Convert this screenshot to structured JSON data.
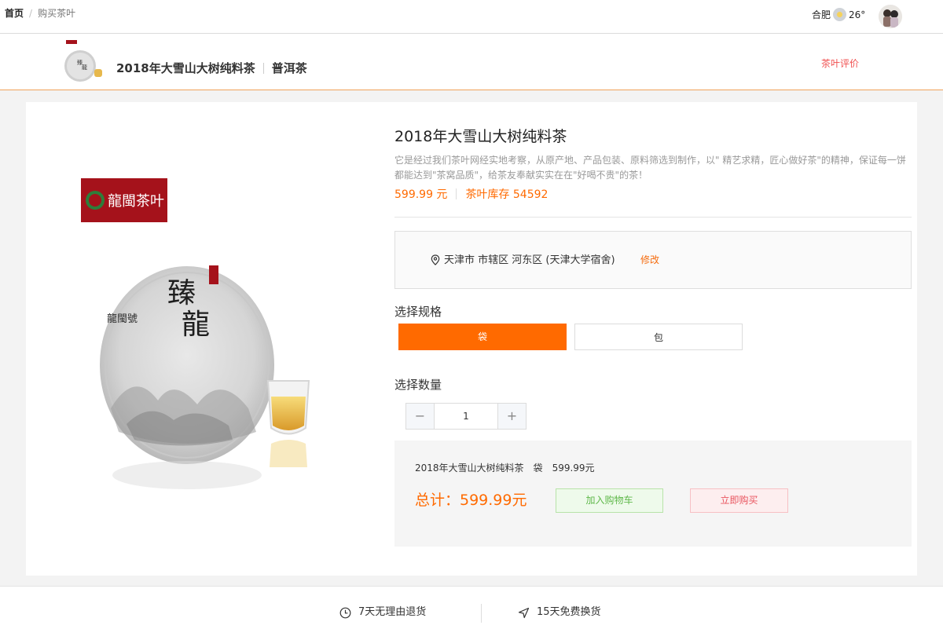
{
  "topbar": {
    "home": "首页",
    "separator": "/",
    "current": "购买茶叶",
    "city": "合肥",
    "temperature": "26°",
    "weather_icon": "sun-icon"
  },
  "product_header": {
    "title": "2018年大雪山大树纯料茶",
    "category": "普洱茶",
    "review_link": "茶叶评价"
  },
  "product": {
    "brand_logo_text": "龍閩茶叶",
    "title": "2018年大雪山大树纯料茶",
    "description": "它是经过我们茶叶网经实地考察，从原产地、产品包装、原料筛选到制作，以\" 精艺求精，匠心做好茶\"的精神，保证每一饼都能达到\"茶窝品质\"，给茶友奉献实实在在\"好喝不贵\"的茶！",
    "price": "599.99 元",
    "stock": "茶叶库存 54592"
  },
  "address": {
    "text": "天津市 市辖区 河东区 (天津大学宿舍)",
    "edit_label": "修改"
  },
  "spec": {
    "label": "选择规格",
    "options": [
      "袋",
      "包"
    ],
    "selected": "袋"
  },
  "quantity": {
    "label": "选择数量",
    "minus": "−",
    "value": "1",
    "plus": "+"
  },
  "summary": {
    "name": "2018年大雪山大树纯料茶",
    "spec": "袋",
    "unit_price": "599.99元",
    "total": "总计：599.99元",
    "add_to_cart": "加入购物车",
    "buy_now": "立即购买"
  },
  "footer": {
    "items": [
      {
        "label": "7天无理由退货",
        "icon": "clock-icon"
      },
      {
        "label": "15天免费换货",
        "icon": "navigation-icon"
      }
    ]
  },
  "colors": {
    "accent": "#ff6a00",
    "cart_green": "#5fb84a",
    "buy_red": "#e9545e",
    "review_red": "#f05050"
  }
}
